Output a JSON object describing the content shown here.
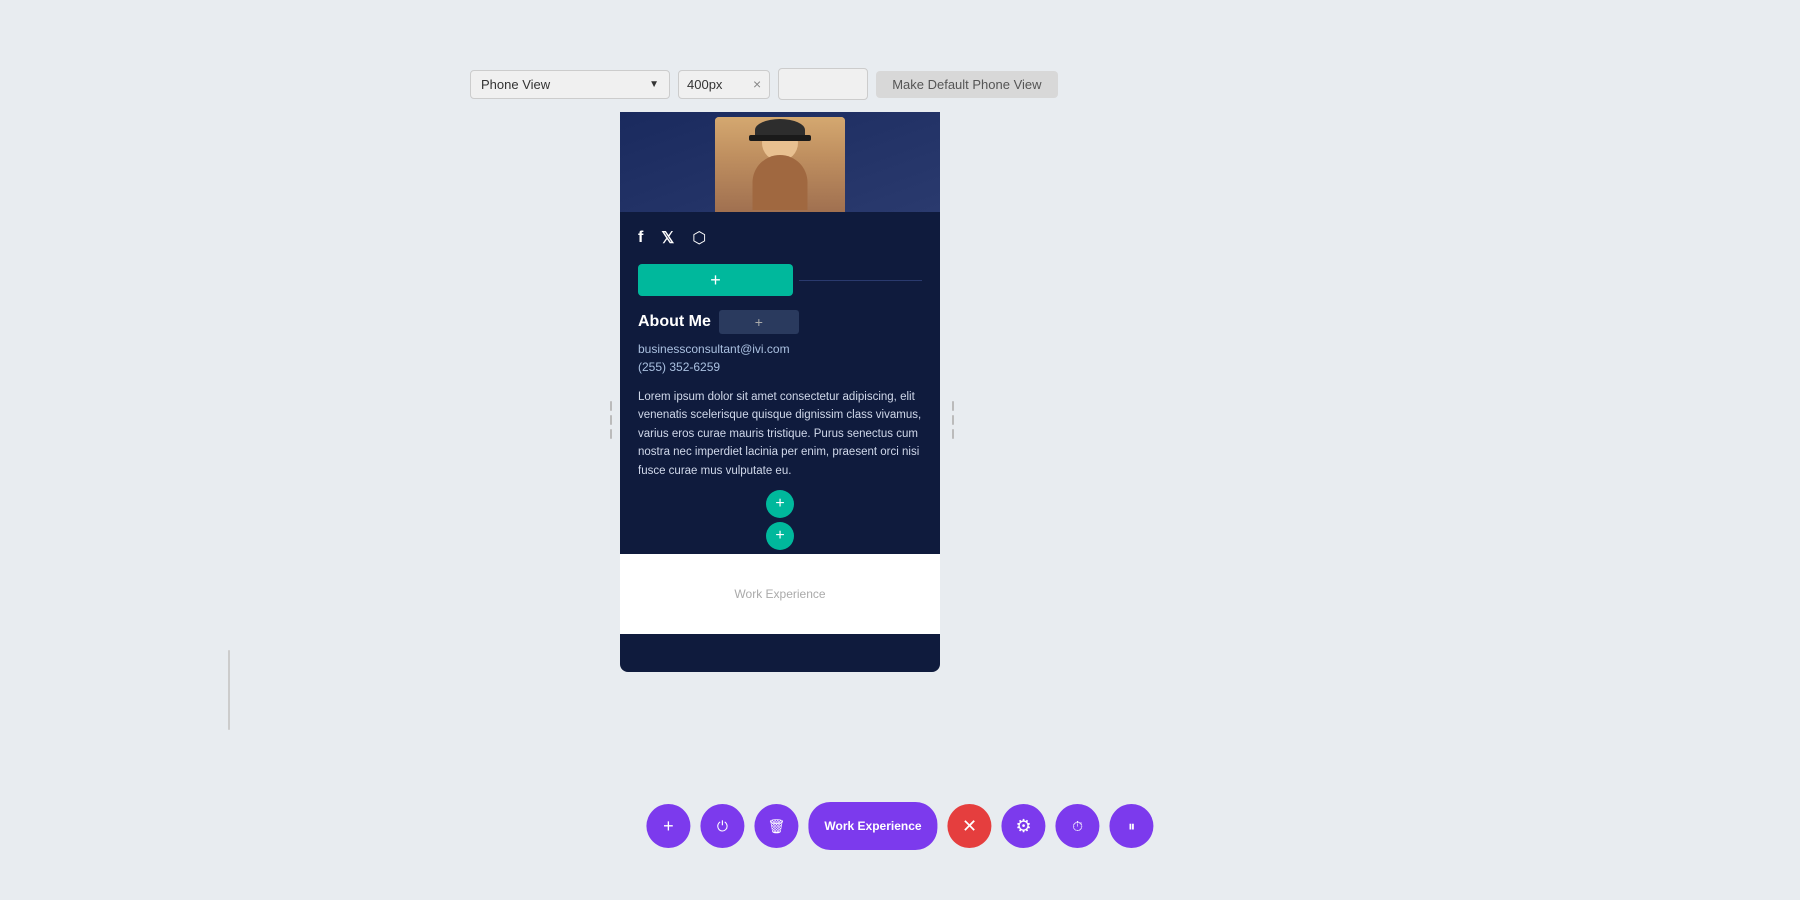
{
  "toolbar": {
    "view_selector": "Phone View",
    "width_value": "400px",
    "close_label": "×",
    "make_default_label": "Make Default Phone View"
  },
  "social": {
    "facebook_icon": "f",
    "twitter_icon": "𝕏",
    "instagram_icon": "◻"
  },
  "green_button": {
    "icon": "+",
    "label": "+"
  },
  "about": {
    "title": "About Me",
    "add_icon": "+",
    "email": "businessconsultant@ivi.com",
    "phone": "(255) 352-6259",
    "bio": "Lorem ipsum dolor sit amet consectetur adipiscing, elit venenatis scelerisque quisque dignissim class vivamus, varius eros curae mauris tristique. Purus senectus cum nostra nec imperdiet lacinia per enim, praesent orci nisi fusce curae mus vulputate eu."
  },
  "bottom_toolbar": {
    "add_label": "+",
    "power_label": "⏻",
    "trash_label": "🗑",
    "section_label": "Work Experience",
    "close_label": "✕",
    "gear_label": "⚙",
    "history_label": "⏱",
    "pause_label": "⏸"
  }
}
